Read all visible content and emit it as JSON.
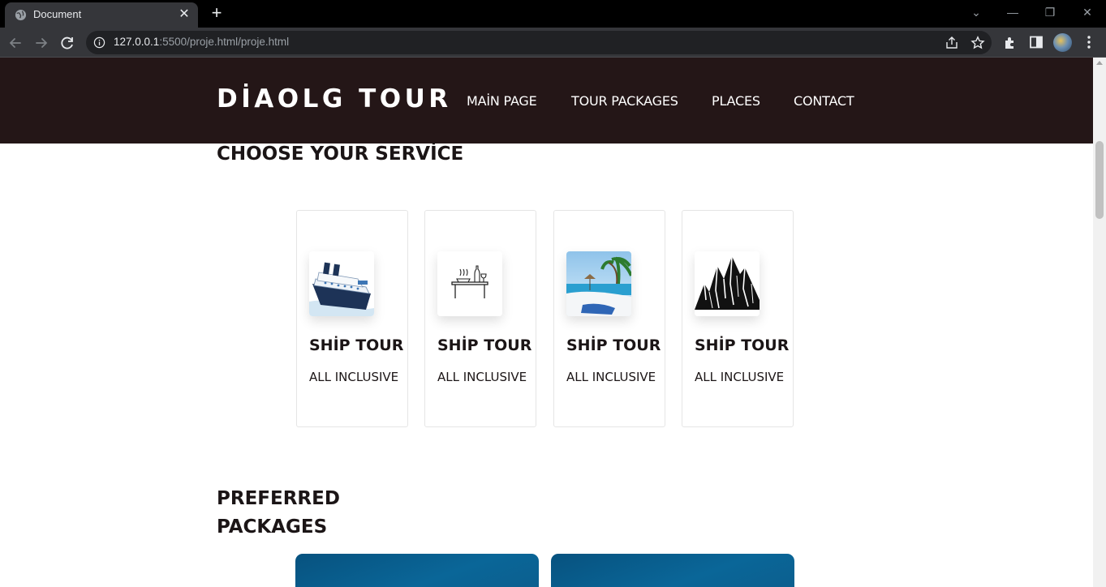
{
  "browser": {
    "tab_title": "Document",
    "tab_close": "✕",
    "new_tab": "+",
    "url_host": "127.0.0.1",
    "url_rest": ":5500/proje.html/proje.html",
    "window_controls": [
      "⌄",
      "—",
      "❐",
      "✕"
    ]
  },
  "site": {
    "brand": "DİAOLG TOUR",
    "nav": [
      "MAİN PAGE",
      "TOUR PACKAGES",
      "PLACES",
      "CONTACT"
    ],
    "services_title": "CHOOSE YOUR SERVİCE",
    "services": [
      {
        "icon": "cruise-ship-image",
        "title": "SHİP TOUR",
        "subtitle": "ALL INCLUSIVE"
      },
      {
        "icon": "dining-table-icon",
        "title": "SHİP TOUR",
        "subtitle": "ALL INCLUSIVE"
      },
      {
        "icon": "beach-image",
        "title": "SHİP TOUR",
        "subtitle": "ALL INCLUSIVE"
      },
      {
        "icon": "mountains-icon",
        "title": "SHİP TOUR",
        "subtitle": "ALL INCLUSIVE"
      }
    ],
    "packages_title": "PREFERRED PACKAGES"
  },
  "colors": {
    "header_bg": "#241617",
    "text_dark": "#1b1516",
    "package_blue": "#0a6698"
  }
}
